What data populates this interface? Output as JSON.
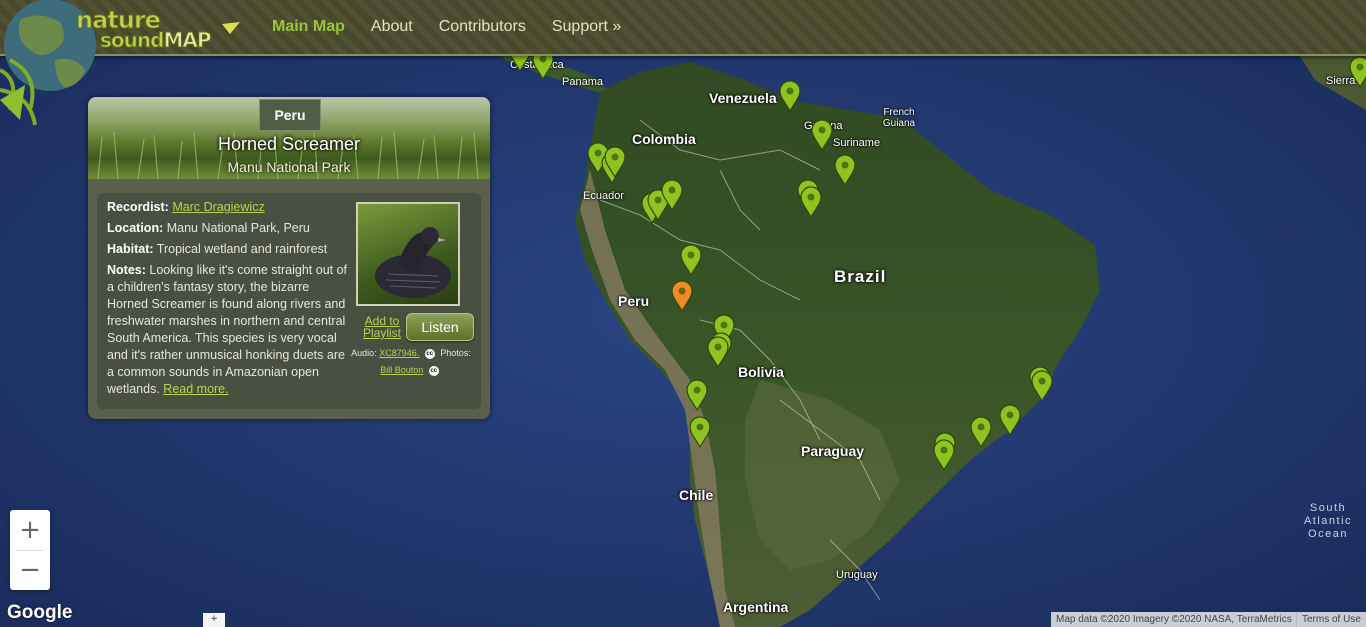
{
  "header": {
    "logo_word1": "nature",
    "logo_word2": "sound",
    "logo_word3": "MAP",
    "nav": [
      {
        "label": "Main Map",
        "active": true
      },
      {
        "label": "About",
        "active": false
      },
      {
        "label": "Contributors",
        "active": false
      },
      {
        "label": "Support »",
        "active": false
      }
    ]
  },
  "map": {
    "labels": {
      "costa_rica": "Costa Rica",
      "panama": "Panama",
      "venezuela": "Venezuela",
      "colombia": "Colombia",
      "guyana": "Guyana",
      "suriname": "Suriname",
      "french_guiana_1": "French",
      "french_guiana_2": "Guiana",
      "ecuador": "Ecuador",
      "brazil": "Brazil",
      "peru": "Peru",
      "bolivia": "Bolivia",
      "paraguay": "Paraguay",
      "chile": "Chile",
      "uruguay": "Uruguay",
      "argentina": "Argentina",
      "sierra": "Sierra",
      "ocean_1": "South",
      "ocean_2": "Atlantic",
      "ocean_3": "Ocean"
    },
    "pin_color": "#8fc31f",
    "selected_pin_color": "#f08a24"
  },
  "panel": {
    "country": "Peru",
    "species": "Horned Screamer",
    "site": "Manu National Park",
    "recordist_label": "Recordist:",
    "recordist": "Marc Dragiewicz",
    "location_label": "Location:",
    "location": "Manu National Park, Peru",
    "habitat_label": "Habitat:",
    "habitat": "Tropical wetland and rainforest",
    "notes_label": "Notes:",
    "notes": "Looking like it's come straight out of a children's fantasy story, the bizarre Horned Screamer is found along rivers and freshwater marshes in northern and central South America. This species is very vocal and it's rather unmusical honking duets are a common sounds in Amazonian open wetlands.",
    "read_more": "Read more.",
    "add_playlist": "Add to Playlist",
    "listen": "Listen",
    "audio_label": "Audio:",
    "audio_id": "XC87946.",
    "photos_label": "Photos:",
    "photographer": "Bill Bouton",
    "cc": "cc"
  },
  "controls": {
    "zoom_in": "+",
    "zoom_out": "−",
    "google": "Google",
    "kbd": "+",
    "attribution": "Map data ©2020 Imagery ©2020 NASA, TerraMetrics",
    "terms": "Terms of Use"
  }
}
